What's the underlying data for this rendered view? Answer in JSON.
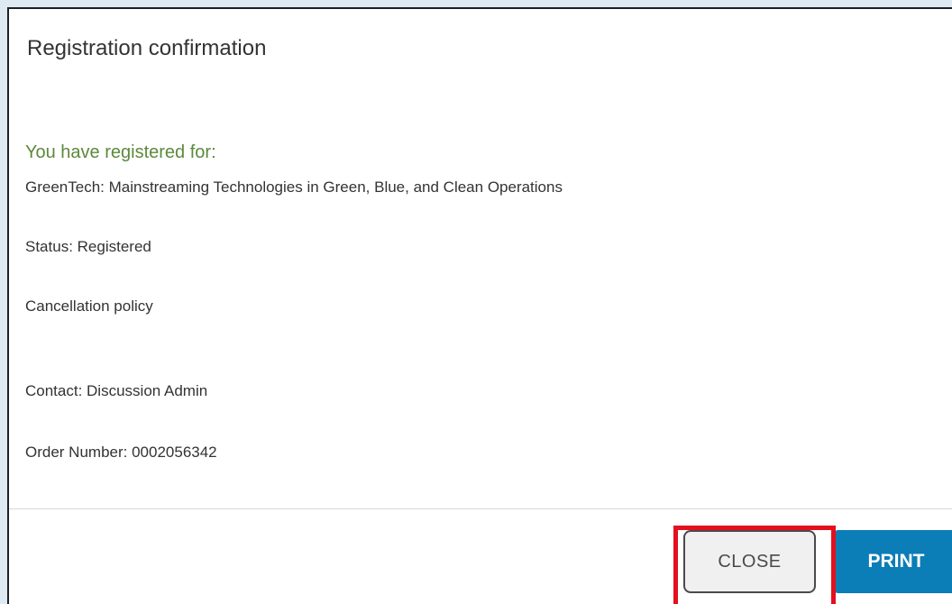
{
  "dialog": {
    "title": "Registration confirmation",
    "registered_heading": "You have registered for:",
    "event_name": "GreenTech: Mainstreaming Technologies in Green, Blue, and Clean Operations",
    "status": "Status: Registered",
    "cancellation_policy": "Cancellation policy",
    "contact": "Contact: Discussion Admin",
    "order_number": "Order Number: 0002056342"
  },
  "buttons": {
    "close_label": "CLOSE",
    "print_label": "PRINT"
  },
  "colors": {
    "heading_green": "#5b8a3a",
    "print_blue": "#0b7db7",
    "highlight_red": "#e3101e",
    "page_background": "#dfe9f3"
  }
}
